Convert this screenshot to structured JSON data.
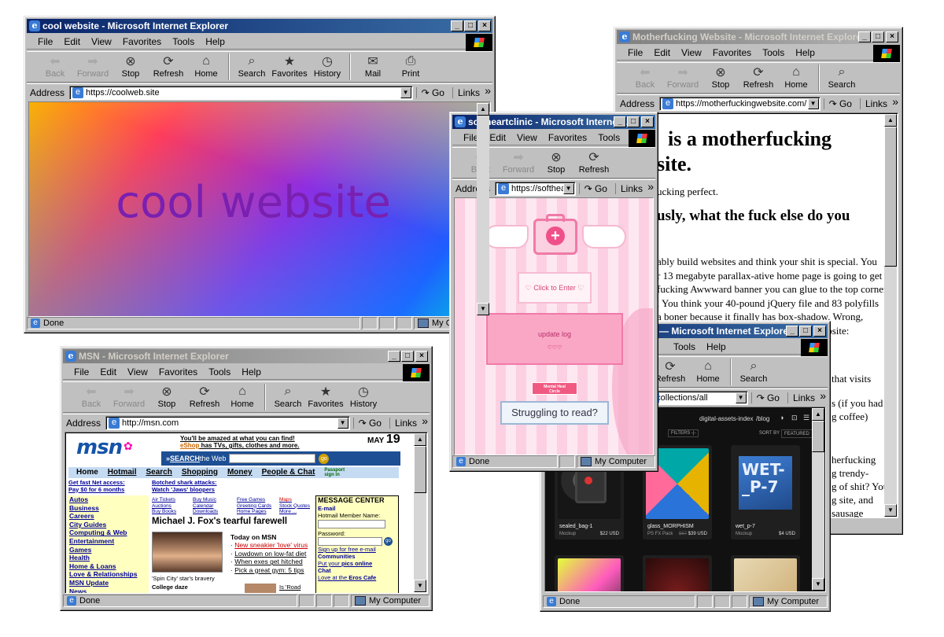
{
  "windows": {
    "cool": {
      "title": "cool website - Microsoft Internet Explorer",
      "url": "https://coolweb.site",
      "heading": "cool website",
      "status": "Done",
      "zone": "My Computer"
    },
    "mf": {
      "title": "Motherfucking Website - Microsoft Internet Explorer",
      "url": "https://motherfuckingwebsite.com/",
      "h1a": "is a motherfucking",
      "h1b": "site.",
      "p1": "ucking perfect.",
      "h2": "usly, what the fuck else do you",
      "p2": [
        "ably build websites and think your shit is special. You",
        "r 13 megabyte parallax-ative home page is going to get",
        "fucking Awwward banner you can glue to the top corner",
        ". You think your 40-pound jQuery file and 83 polyfills",
        "a boner because it finally has box-shadow. Wrong,",
        "cker. Let me describe your perfect-ass website:"
      ],
      "p3": "that visits",
      "p4a": "s (if you had",
      "p4b": "g coffee)",
      "p5": [
        "herfucking",
        "g trendy-",
        "g of shit? You",
        "g site, and",
        "sausage"
      ]
    },
    "soft": {
      "title": "softheartclinic - Microsoft Internet...",
      "url": "https://softhea...",
      "enter": "♡ Click to Enter ♡",
      "update": "update log",
      "hearts": "♡♡♡",
      "badge1": "Mental Heal",
      "badge2": "Circle",
      "struggle": "Struggling to read?",
      "status": "Done",
      "zone": "My Computer"
    },
    "msn": {
      "title": "MSN - Microsoft Internet Explorer",
      "url": "http://msn.com",
      "promo1": "You'll be amazed at what you can find!",
      "promo2a": "eShop",
      "promo2b": " has TVs, gifts, clothes and more.",
      "date_month": "MAY",
      "date_day": "19",
      "logo": "msn",
      "search_a": "SEARCH",
      "search_b": " the Web",
      "go": "go",
      "nav": [
        "Home",
        "Hotmail",
        "Search",
        "Shopping",
        "Money",
        "People & Chat"
      ],
      "passport1": "Passport",
      "passport2": "sign in",
      "promo_l1": "Get fast Net access:",
      "promo_l2": "Pay $0 for 6 months",
      "promo_r1": "Botched shark attacks:",
      "promo_r2": "Watch 'Jaws' bloopers",
      "left": [
        "Autos",
        "Business",
        "Careers",
        "City Guides",
        "Computing & Web",
        "Entertainment",
        "Games",
        "Health",
        "Home & Loans",
        "Love & Relationships",
        "MSN Update",
        "News"
      ],
      "links_c1": [
        "Air Tickets",
        "Auctions",
        "Buy Books"
      ],
      "links_c2": [
        "Buy Music",
        "Calendar",
        "Downloads"
      ],
      "links_c3": [
        "Free Games",
        "Greeting Cards",
        "Home Pages"
      ],
      "links_c4": [
        "Maps",
        "Stock Quotes",
        "More ..."
      ],
      "headline": "Michael J. Fox's tearful farewell",
      "today": "Today on MSN",
      "items": [
        "New sneakier 'love' virus",
        "Lowdown on low-fat diet",
        "When exes get hitched",
        "Pick a great gym: 5 tips"
      ],
      "caption": "'Spin City' star's bravery",
      "college": "College daze",
      "isroad": "Is 'Road",
      "mc_title": "MESSAGE CENTER",
      "mc_email": "E-mail",
      "mc_member": "Hotmail Member Name:",
      "mc_pass": "Password:",
      "mc_signup": "Sign up for free e-mail",
      "mc_comm": "Communities",
      "mc_put_a": "Put your ",
      "mc_put_b": "pics online",
      "mc_chat": "Chat",
      "mc_love_a": "Love at the ",
      "mc_love_b": "Eros Cafe",
      "status": "Done",
      "zone": "My Computer"
    },
    "shop": {
      "title": "— Microsoft Internet Explorer",
      "url": "o/collections/all",
      "nav1": "digital-assets-index",
      "nav2": "/blog",
      "filters": "FILTERS -|-",
      "sort": "SORT BY",
      "featured": "FEATURED ⌄",
      "products": [
        {
          "name": "sealed_bag-1",
          "meta": "Mockup",
          "price": "$22 USD"
        },
        {
          "name": "glass_MORPHISM",
          "meta": "PS FX Pack",
          "price": "$39 USD",
          "old": "$67"
        },
        {
          "name": "wet_p-7",
          "meta": "Mockup",
          "price": "$4 USD"
        }
      ],
      "wet_text": "WET-_P-7",
      "status": "Done",
      "zone": "My Computer"
    }
  },
  "menu": [
    "File",
    "Edit",
    "View",
    "Favorites",
    "Tools",
    "Help"
  ],
  "toolbar": [
    "Back",
    "Forward",
    "Stop",
    "Refresh",
    "Home",
    "Search",
    "Favorites",
    "History",
    "Mail",
    "Print"
  ],
  "address_label": "Address",
  "go_label": "Go",
  "links_label": "Links"
}
